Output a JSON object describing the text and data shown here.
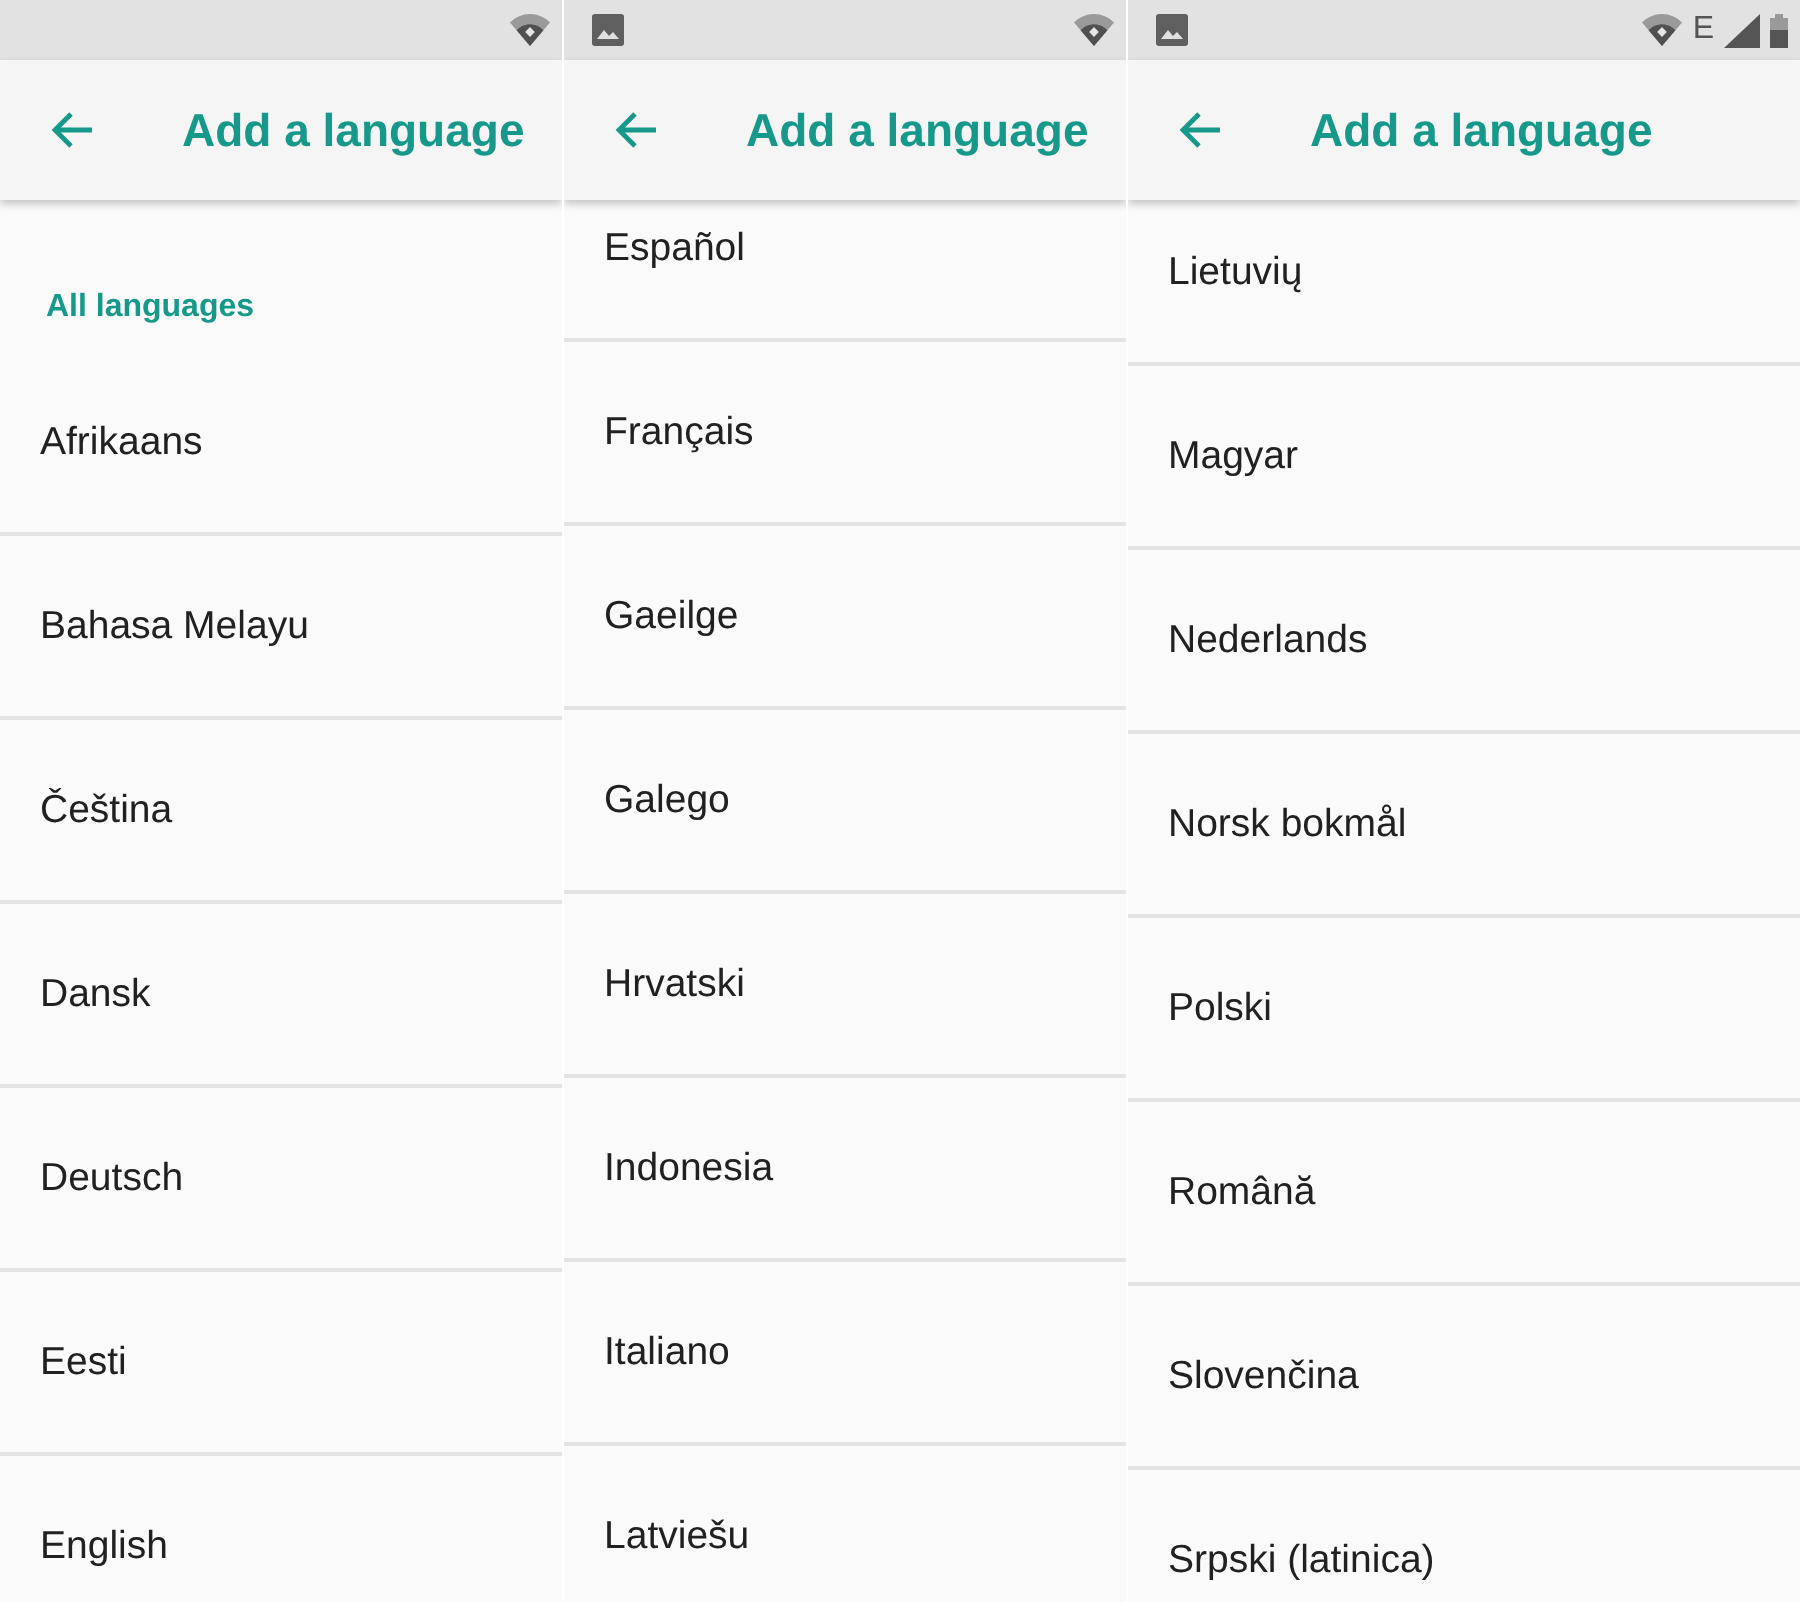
{
  "panels": [
    {
      "status_bar": {
        "system": [
          {
            "kind": "wifi"
          }
        ]
      },
      "title": "Add a language",
      "section_header": "All languages",
      "languages": [
        "Afrikaans",
        "Bahasa Melayu",
        "Čeština",
        "Dansk",
        "Deutsch",
        "Eesti",
        "English"
      ]
    },
    {
      "status_bar": {
        "notifications": [
          {
            "kind": "image"
          }
        ],
        "system": [
          {
            "kind": "wifi"
          }
        ]
      },
      "title": "Add a language",
      "languages": [
        "Español",
        "Français",
        "Gaeilge",
        "Galego",
        "Hrvatski",
        "Indonesia",
        "Italiano",
        "Latviešu"
      ]
    },
    {
      "status_bar": {
        "notifications": [
          {
            "kind": "image"
          }
        ],
        "system": [
          {
            "kind": "wifi"
          },
          {
            "kind": "network_type",
            "label": "E"
          },
          {
            "kind": "signal"
          },
          {
            "kind": "battery"
          }
        ]
      },
      "title": "Add a language",
      "languages": [
        "Lietuvių",
        "Magyar",
        "Nederlands",
        "Norsk bokmål",
        "Polski",
        "Română",
        "Slovenčina",
        "Srpski (latinica)"
      ]
    }
  ]
}
